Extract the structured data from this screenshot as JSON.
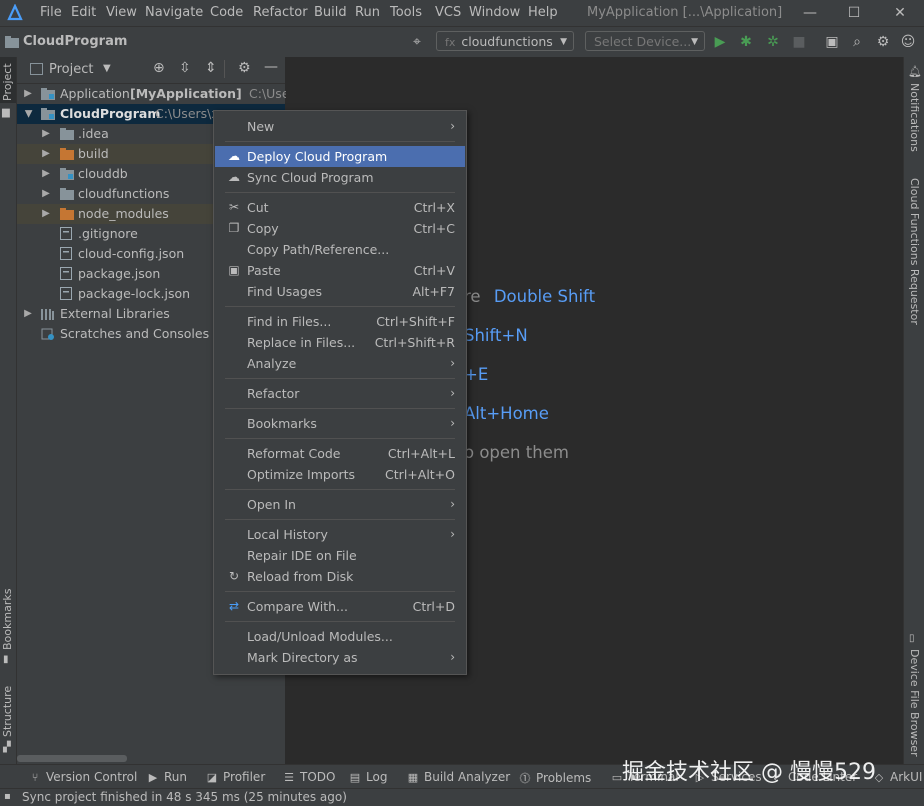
{
  "titlebar": {
    "menus": [
      "File",
      "Edit",
      "View",
      "Navigate",
      "Code",
      "Refactor",
      "Build",
      "Run",
      "Tools",
      "VCS",
      "Window",
      "Help"
    ],
    "window_title": "MyApplication [...\\Application]",
    "minimize": "—",
    "maximize": "☐",
    "close": "✕"
  },
  "navbar": {
    "project": "CloudProgram",
    "run_config": "cloudfunctions",
    "device_select": "Select Device..."
  },
  "project_panel": {
    "title": "Project",
    "tree": [
      {
        "label": "Application",
        "bold": "[MyApplication]",
        "path": "C:\\Users"
      },
      {
        "label": "CloudProgram",
        "path": "C:\\Users\\x"
      },
      {
        "label": ".idea"
      },
      {
        "label": "build"
      },
      {
        "label": "clouddb"
      },
      {
        "label": "cloudfunctions"
      },
      {
        "label": "node_modules"
      },
      {
        "label": ".gitignore"
      },
      {
        "label": "cloud-config.json"
      },
      {
        "label": "package.json"
      },
      {
        "label": "package-lock.json"
      },
      {
        "label": "External Libraries"
      },
      {
        "label": "Scratches and Consoles"
      }
    ]
  },
  "left_strip": {
    "project": "Project",
    "bookmarks": "Bookmarks",
    "structure": "Structure"
  },
  "right_strip": {
    "notifications": "Notifications",
    "cloud_functions_requestor": "Cloud Functions Requestor",
    "device_file_browser": "Device File Browser"
  },
  "editor_hints": [
    {
      "text": "re",
      "key": "Double Shift"
    },
    {
      "text": "",
      "key": "Shift+N"
    },
    {
      "text": "",
      "key": "+E"
    },
    {
      "text": "",
      "key": "Alt+Home"
    },
    {
      "text": "o open them",
      "key": ""
    }
  ],
  "context_menu": {
    "items": [
      {
        "label": "New",
        "shortcut": "",
        "submenu": true
      },
      {
        "label": "Deploy Cloud Program",
        "shortcut": "",
        "submenu": false,
        "active": true
      },
      {
        "label": "Sync Cloud Program",
        "shortcut": "",
        "submenu": false
      },
      {
        "label": "Cut",
        "shortcut": "Ctrl+X",
        "submenu": false
      },
      {
        "label": "Copy",
        "shortcut": "Ctrl+C",
        "submenu": false
      },
      {
        "label": "Copy Path/Reference...",
        "shortcut": "",
        "submenu": false
      },
      {
        "label": "Paste",
        "shortcut": "Ctrl+V",
        "submenu": false
      },
      {
        "label": "Find Usages",
        "shortcut": "Alt+F7",
        "submenu": false
      },
      {
        "label": "Find in Files...",
        "shortcut": "Ctrl+Shift+F",
        "submenu": false
      },
      {
        "label": "Replace in Files...",
        "shortcut": "Ctrl+Shift+R",
        "submenu": false
      },
      {
        "label": "Analyze",
        "shortcut": "",
        "submenu": true
      },
      {
        "label": "Refactor",
        "shortcut": "",
        "submenu": true
      },
      {
        "label": "Bookmarks",
        "shortcut": "",
        "submenu": true
      },
      {
        "label": "Reformat Code",
        "shortcut": "Ctrl+Alt+L",
        "submenu": false
      },
      {
        "label": "Optimize Imports",
        "shortcut": "Ctrl+Alt+O",
        "submenu": false
      },
      {
        "label": "Open In",
        "shortcut": "",
        "submenu": true
      },
      {
        "label": "Local History",
        "shortcut": "",
        "submenu": true
      },
      {
        "label": "Repair IDE on File",
        "shortcut": "",
        "submenu": false
      },
      {
        "label": "Reload from Disk",
        "shortcut": "",
        "submenu": false
      },
      {
        "label": "Compare With...",
        "shortcut": "Ctrl+D",
        "submenu": false
      },
      {
        "label": "Load/Unload Modules...",
        "shortcut": "",
        "submenu": false
      },
      {
        "label": "Mark Directory as",
        "shortcut": "",
        "submenu": true
      }
    ]
  },
  "bottom_tabs": [
    "Version Control",
    "Run",
    "Profiler",
    "TODO",
    "Log",
    "Build Analyzer",
    "Problems",
    "Terminal",
    "Services",
    "Code Linter",
    "ArkUI"
  ],
  "status": "Sync project finished in 48 s 345 ms (25 minutes ago)",
  "watermark": "掘金技术社区 @ 慢慢529",
  "colors": {
    "accent": "#4b6eaf",
    "link_blue": "#589df6",
    "folder_orange": "#c57633",
    "run_green": "#499c54"
  }
}
